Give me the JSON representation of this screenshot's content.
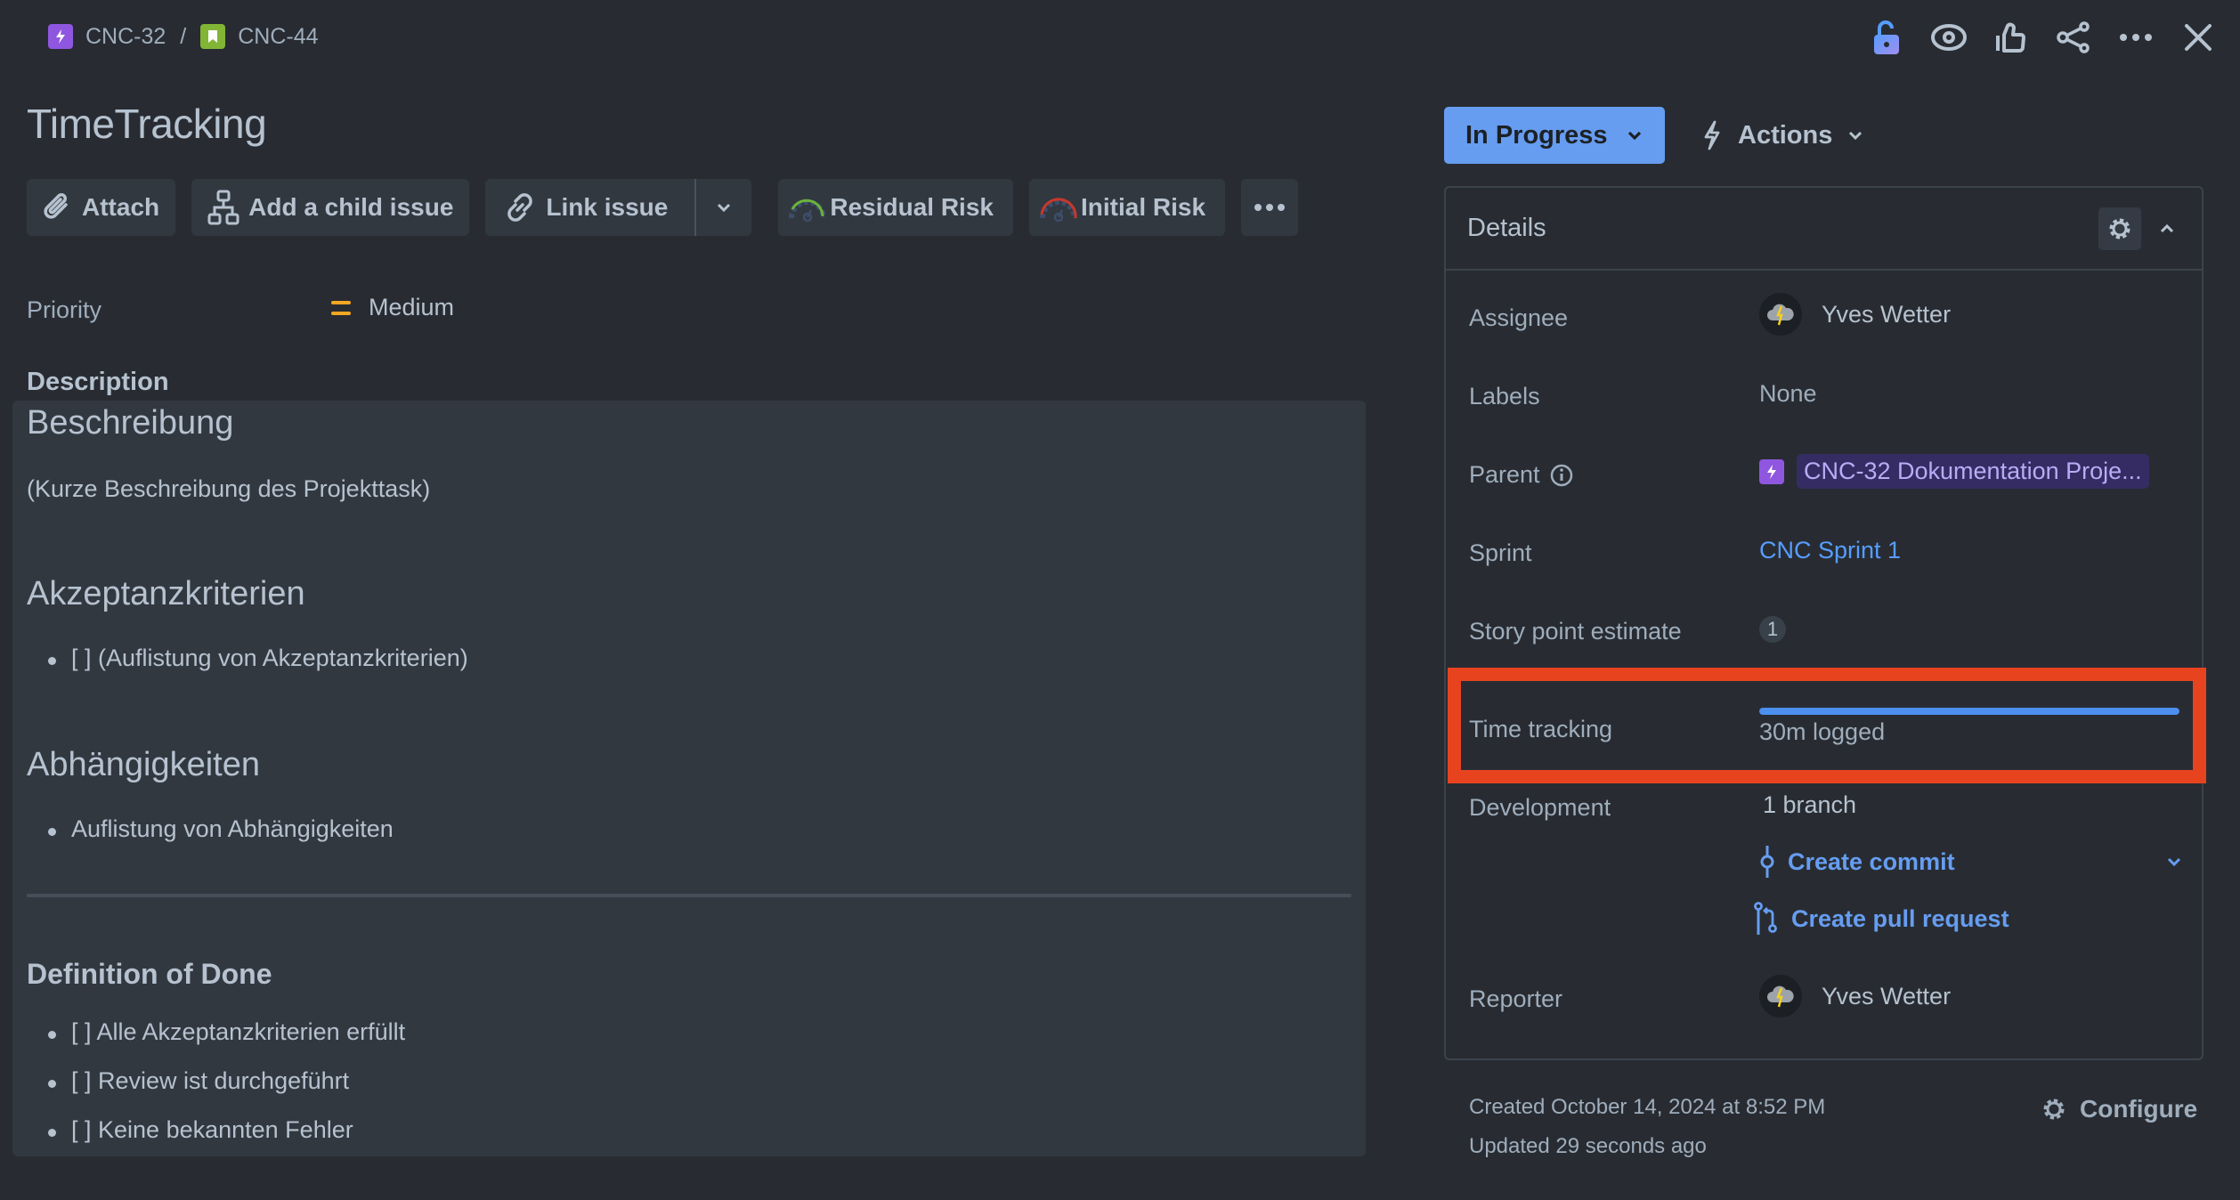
{
  "breadcrumb": [
    {
      "key": "CNC-32",
      "type": "epic"
    },
    {
      "key": "CNC-44",
      "type": "story"
    }
  ],
  "breadcrumb_separator": "/",
  "top_icons": [
    "unlock-icon",
    "watch-icon",
    "like-icon",
    "share-icon",
    "more-icon",
    "close-icon"
  ],
  "issue": {
    "title": "TimeTracking"
  },
  "toolbar": {
    "attach": "Attach",
    "add_child": "Add a child issue",
    "link_issue": "Link issue",
    "residual_risk": "Residual Risk",
    "initial_risk": "Initial Risk"
  },
  "priority": {
    "label": "Priority",
    "value": "Medium",
    "color": "#f5a623"
  },
  "description": {
    "label": "Description",
    "sections": {
      "beschreibung": {
        "heading": "Beschreibung",
        "text": "(Kurze Beschreibung des Projekttask)"
      },
      "akzeptanz": {
        "heading": "Akzeptanzkriterien",
        "items": [
          "[ ] (Auflistung von Akzeptanzkriterien)"
        ]
      },
      "abhaengigkeiten": {
        "heading": "Abhängigkeiten",
        "items": [
          "Auflistung von Abhängigkeiten"
        ]
      },
      "dod": {
        "heading": "Definition of Done",
        "items": [
          "[ ] Alle Akzeptanzkriterien erfüllt",
          "[ ] Review ist durchgeführt",
          "[ ] Keine bekannten Fehler"
        ]
      }
    }
  },
  "status": {
    "label": "In Progress",
    "color": "#669df1"
  },
  "actions": {
    "label": "Actions"
  },
  "details": {
    "title": "Details",
    "assignee": {
      "label": "Assignee",
      "value": "Yves Wetter"
    },
    "labels": {
      "label": "Labels",
      "value": "None"
    },
    "parent": {
      "label": "Parent",
      "value": "CNC-32 Dokumentation Proje..."
    },
    "sprint": {
      "label": "Sprint",
      "value": "CNC Sprint 1"
    },
    "story_points": {
      "label": "Story point estimate",
      "value": "1"
    },
    "time_tracking": {
      "label": "Time tracking",
      "value": "30m logged",
      "progress_percent": 100
    },
    "development": {
      "label": "Development",
      "branches": "1 branch",
      "create_commit": "Create commit",
      "create_pr": "Create pull request"
    },
    "reporter": {
      "label": "Reporter",
      "value": "Yves Wetter"
    }
  },
  "meta": {
    "created": "Created October 14, 2024 at 8:52 PM",
    "updated": "Updated 29 seconds ago",
    "configure": "Configure"
  },
  "colors": {
    "background": "#282c32",
    "panel": "#323840",
    "highlight": "#e8431f",
    "link": "#579dff"
  }
}
